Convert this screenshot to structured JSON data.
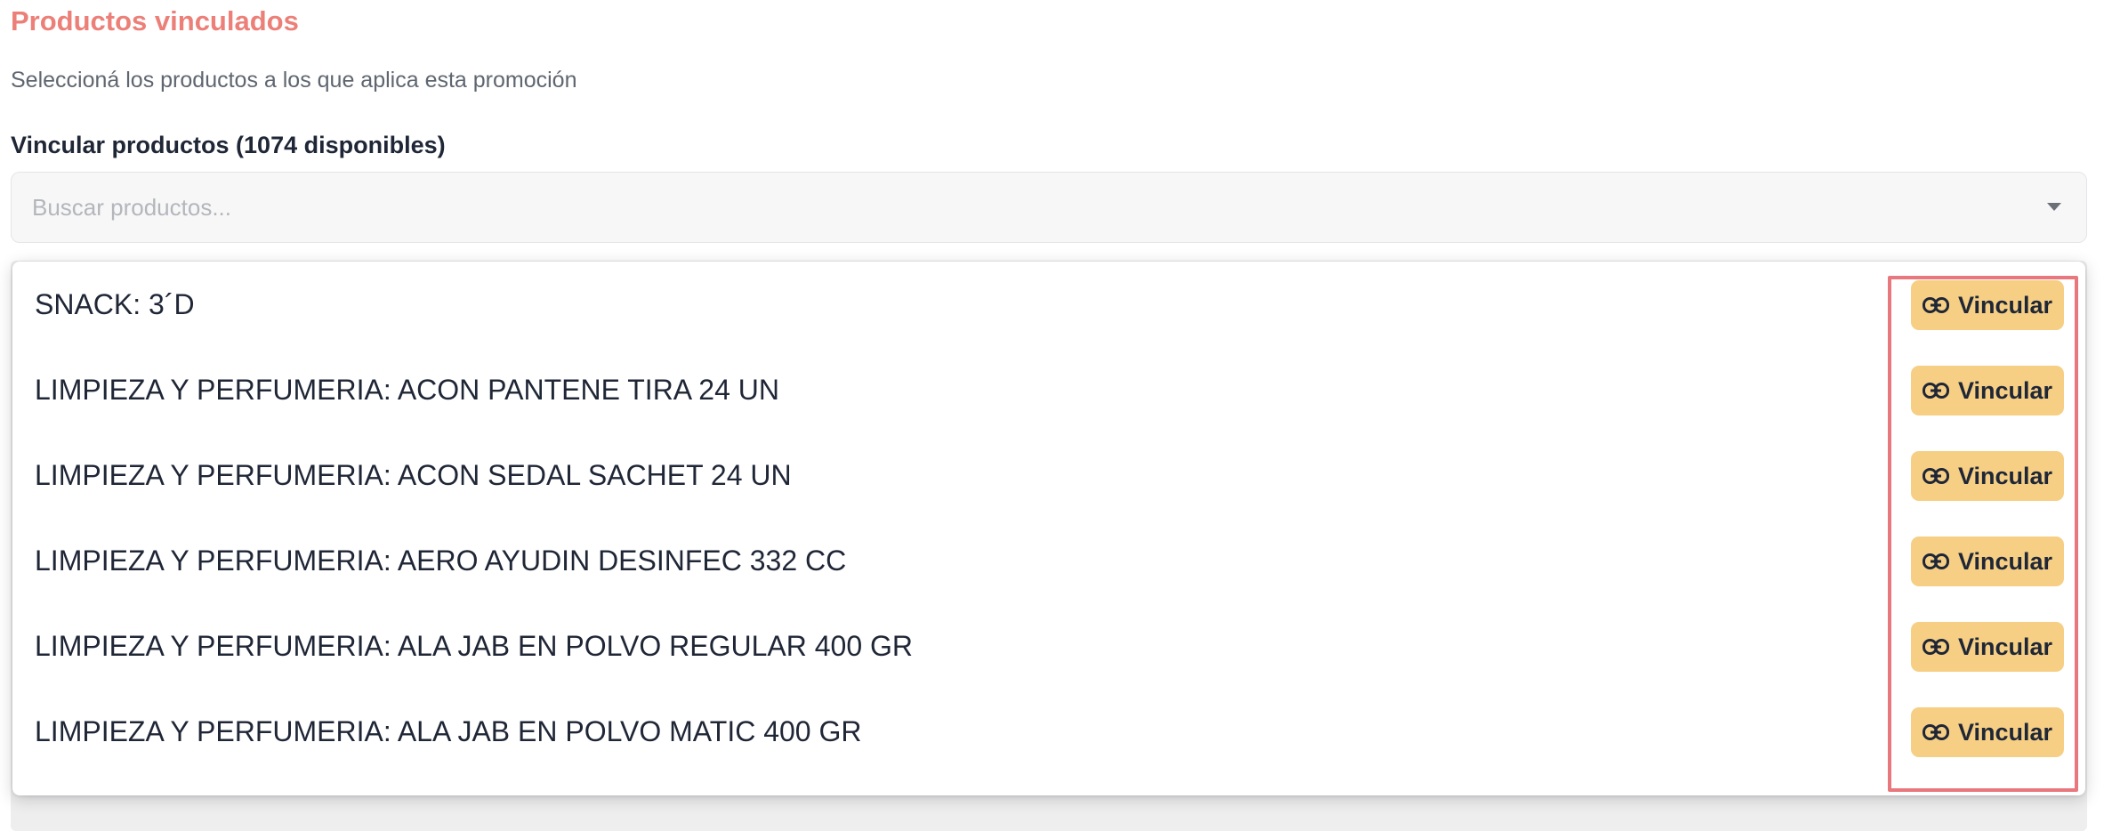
{
  "section": {
    "title": "Productos vinculados",
    "subtitle": "Seleccioná los productos a los que aplica esta promoción"
  },
  "link_field": {
    "label": "Vincular productos (1074 disponibles)",
    "placeholder": "Buscar productos...",
    "caret_icon": "chevron-down-icon"
  },
  "dropdown": {
    "items": [
      {
        "label": "SNACK: 3´D",
        "action": "Vincular"
      },
      {
        "label": "LIMPIEZA Y PERFUMERIA: ACON PANTENE TIRA 24 UN",
        "action": "Vincular"
      },
      {
        "label": "LIMPIEZA Y PERFUMERIA: ACON SEDAL SACHET 24 UN",
        "action": "Vincular"
      },
      {
        "label": "LIMPIEZA Y PERFUMERIA: AERO AYUDIN DESINFEC 332 CC",
        "action": "Vincular"
      },
      {
        "label": "LIMPIEZA Y PERFUMERIA: ALA JAB EN POLVO REGULAR 400 GR",
        "action": "Vincular"
      },
      {
        "label": "LIMPIEZA Y PERFUMERIA: ALA JAB EN POLVO MATIC 400 GR",
        "action": "Vincular"
      }
    ],
    "action_icon": "link-icon"
  },
  "colors": {
    "title": "#ec8078",
    "button_bg": "#f6cf85",
    "highlight": "#e8787e",
    "text": "#1f2636"
  }
}
